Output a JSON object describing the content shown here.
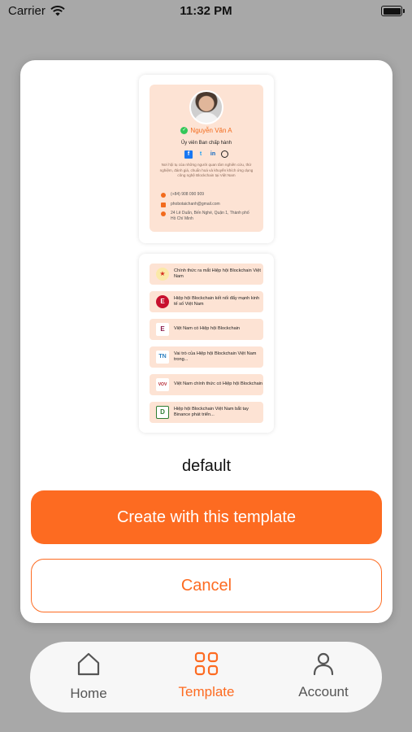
{
  "status_bar": {
    "carrier": "Carrier",
    "time": "11:32 PM"
  },
  "profile": {
    "name": "Nguyễn Văn A",
    "title": "Ủy viên Ban chấp hành",
    "description": "Nơi hội tụ của những người quan tâm nghiên cứu, thử nghiệm, đánh giá, chuẩn hoá và khuyến khích ứng dụng công nghệ Blockchain tại Việt Nam",
    "phone": "(+84) 908 090 909",
    "email": "phobotaichanh@gmail.com",
    "address": "24 Lê Duẩn, Bến Nghé, Quận 1, Thành phố Hồ Chí Minh"
  },
  "news": [
    {
      "title": "Chính thức ra mắt Hiệp hội Blockchain Việt Nam",
      "logo": "emblem-icon",
      "color": "#d62b1f",
      "glyph": "★"
    },
    {
      "title": "Hiệp hội Blockchain kết nối đẩy mạnh kinh tế số Việt Nam",
      "logo": "e-icon",
      "color": "#c8102e",
      "glyph": "E"
    },
    {
      "title": "Việt Nam có Hiệp hội Blockchain",
      "logo": "e-square-icon",
      "color": "#8b1a4a",
      "glyph": "E"
    },
    {
      "title": "Vai trò của Hiệp hội Blockchain Việt Nam trong...",
      "logo": "tn-icon",
      "color": "#2a7fc1",
      "glyph": "TN"
    },
    {
      "title": "Việt Nam chính thức có Hiệp hội Blockchain",
      "logo": "vov-icon",
      "color": "#b3202a",
      "glyph": "VOV"
    },
    {
      "title": "Hiệp hội Blockchain Việt Nam bắt tay Binance phát triển...",
      "logo": "d-icon",
      "color": "#2e7d32",
      "glyph": "D"
    }
  ],
  "template_name": "default",
  "buttons": {
    "create": "Create with this template",
    "cancel": "Cancel"
  },
  "tabs": {
    "home": "Home",
    "template": "Template",
    "account": "Account"
  },
  "colors": {
    "accent": "#fd6b21",
    "card_bg": "#fde3d4"
  }
}
